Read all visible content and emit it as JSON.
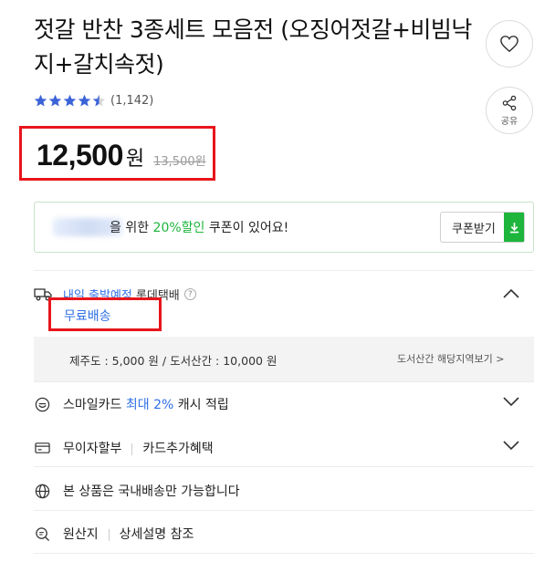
{
  "product": {
    "title": "젓갈 반찬 3종세트 모음전 (오징어젓갈+비빔낙지+갈치속젓)",
    "rating": 4.5,
    "review_count": "(1,142)",
    "price": "12,500",
    "price_unit": "원",
    "original_price": "13,500원"
  },
  "actions": {
    "wishlist_icon": "heart-icon",
    "share_icon": "share-icon",
    "share_label": "공유"
  },
  "coupon": {
    "text_before": "을 위한 ",
    "highlight": "20%할인",
    "text_after": " 쿠폰이 있어요!",
    "button_label": "쿠폰받기",
    "accent_color": "#1db53c"
  },
  "shipping": {
    "schedule": "내일 출발예정",
    "carrier": "롯데택배",
    "help": "?",
    "free_label": "무료배송",
    "extra_fee": "제주도 : 5,000 원 / 도서산간 : 10,000 원",
    "region_link": "도서산간 해당지역보기 >"
  },
  "benefits": [
    {
      "icon": "smile-icon",
      "prefix": "스마일카드 ",
      "highlight": "최대 2%",
      "suffix": " 캐시 적립"
    },
    {
      "icon": "card-icon",
      "left": "무이자할부",
      "right": "카드추가혜택"
    },
    {
      "icon": "globe-icon",
      "text": "본 상품은 국내배송만 가능합니다"
    },
    {
      "icon": "search-icon",
      "left": "원산지",
      "right": "상세설명 참조"
    }
  ],
  "colors": {
    "highlight_box": "#e8151b",
    "link_blue": "#2f6fe5",
    "star": "#3b63d8"
  }
}
